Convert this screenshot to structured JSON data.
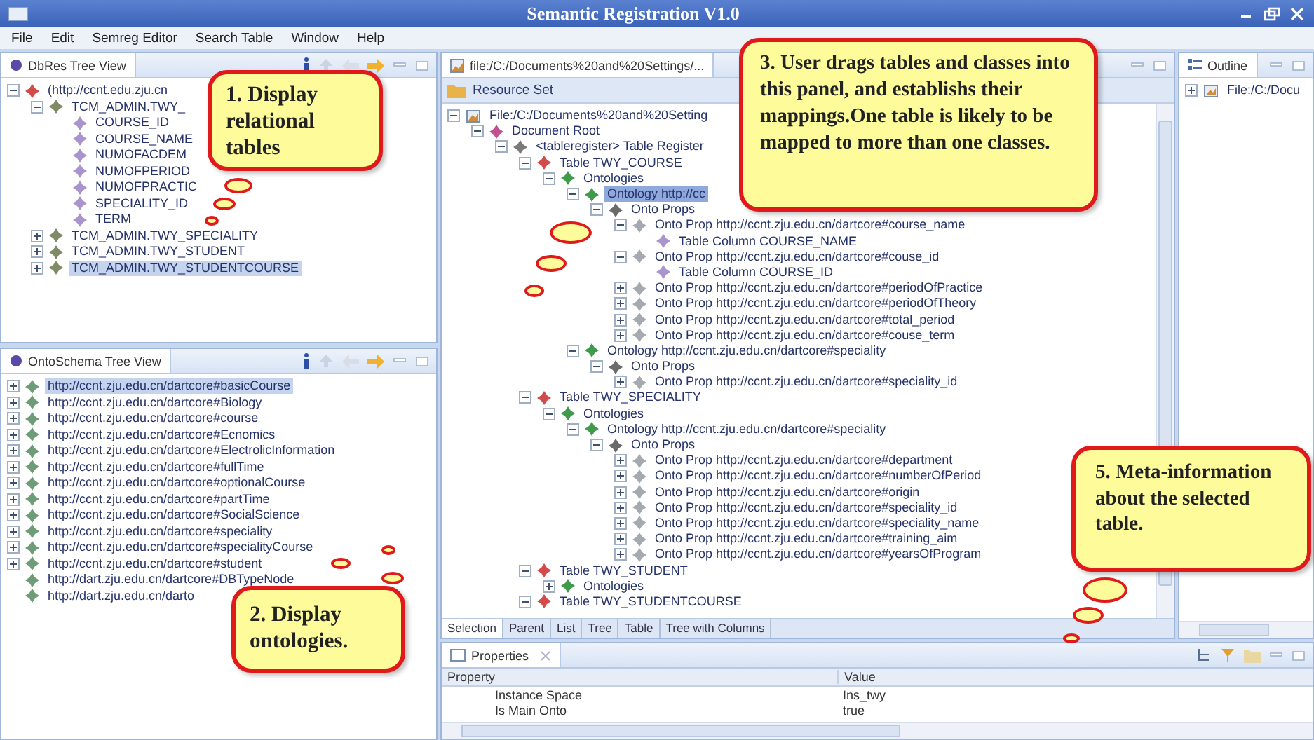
{
  "window": {
    "title": "Semantic Registration  V1.0"
  },
  "menu": [
    {
      "label": "File"
    },
    {
      "label": "Edit"
    },
    {
      "label": "Semreg Editor"
    },
    {
      "label": "Search Table"
    },
    {
      "label": "Window"
    },
    {
      "label": "Help"
    }
  ],
  "dbres_view": {
    "title": "DbRes Tree View",
    "tree": [
      {
        "label": "(http://ccnt.edu.zju.cn",
        "kind": "root",
        "expanded": true,
        "selected": false,
        "children": [
          {
            "label": "TCM_ADMIN.TWY_",
            "kind": "dbtable",
            "expanded": true,
            "selected": false,
            "children": [
              {
                "label": "COURSE_ID",
                "kind": "column",
                "selected": false
              },
              {
                "label": "COURSE_NAME",
                "kind": "column",
                "selected": false
              },
              {
                "label": "NUMOFACDEM",
                "kind": "column",
                "selected": false
              },
              {
                "label": "NUMOFPERIOD",
                "kind": "column",
                "selected": false
              },
              {
                "label": "NUMOFPRACTIC",
                "kind": "column",
                "selected": false
              },
              {
                "label": "SPECIALITY_ID",
                "kind": "column",
                "selected": false
              },
              {
                "label": "TERM",
                "kind": "column",
                "selected": false
              }
            ]
          },
          {
            "label": "TCM_ADMIN.TWY_SPECIALITY",
            "kind": "dbtable",
            "expanded": false,
            "selected": false
          },
          {
            "label": "TCM_ADMIN.TWY_STUDENT",
            "kind": "dbtable",
            "expanded": false,
            "selected": false
          },
          {
            "label": "TCM_ADMIN.TWY_STUDENTCOURSE",
            "kind": "dbtable",
            "expanded": false,
            "selected": true
          }
        ]
      }
    ]
  },
  "ontoschema_view": {
    "title": "OntoSchema Tree View",
    "tree": [
      {
        "label": "http://ccnt.zju.edu.cn/dartcore#basicCourse",
        "kind": "concept",
        "expanded": false,
        "selected": true
      },
      {
        "label": "http://ccnt.zju.edu.cn/dartcore#Biology",
        "kind": "concept",
        "expanded": false,
        "selected": false
      },
      {
        "label": "http://ccnt.zju.edu.cn/dartcore#course",
        "kind": "concept",
        "expanded": false,
        "selected": false
      },
      {
        "label": "http://ccnt.zju.edu.cn/dartcore#Ecnomics",
        "kind": "concept",
        "expanded": false,
        "selected": false
      },
      {
        "label": "http://ccnt.zju.edu.cn/dartcore#ElectrolicInformation",
        "kind": "concept",
        "expanded": false,
        "selected": false
      },
      {
        "label": "http://ccnt.zju.edu.cn/dartcore#fullTime",
        "kind": "concept",
        "expanded": false,
        "selected": false
      },
      {
        "label": "http://ccnt.zju.edu.cn/dartcore#optionalCourse",
        "kind": "concept",
        "expanded": false,
        "selected": false
      },
      {
        "label": "http://ccnt.zju.edu.cn/dartcore#partTime",
        "kind": "concept",
        "expanded": false,
        "selected": false
      },
      {
        "label": "http://ccnt.zju.edu.cn/dartcore#SocialScience",
        "kind": "concept",
        "expanded": false,
        "selected": false
      },
      {
        "label": "http://ccnt.zju.edu.cn/dartcore#speciality",
        "kind": "concept",
        "expanded": false,
        "selected": false
      },
      {
        "label": "http://ccnt.zju.edu.cn/dartcore#specialityCourse",
        "kind": "concept",
        "expanded": false,
        "selected": false
      },
      {
        "label": "http://ccnt.zju.edu.cn/dartcore#student",
        "kind": "concept",
        "expanded": false,
        "selected": false
      },
      {
        "label": "http://dart.zju.edu.cn/dartcore#DBTypeNode",
        "kind": "concept",
        "selected": false
      },
      {
        "label": "http://dart.zju.edu.cn/darto",
        "kind": "concept",
        "selected": false
      }
    ]
  },
  "editor": {
    "tab": "file:/C:/Documents%20and%20Settings/...",
    "header": "Resource Set",
    "tree": [
      {
        "label": "File:/C:/Documents%20and%20Setting",
        "kind": "file",
        "expanded": true,
        "selected": false,
        "children": [
          {
            "label": "Document Root",
            "kind": "docroot",
            "expanded": true,
            "selected": false,
            "children": [
              {
                "label": "<tableregister> Table Register",
                "kind": "register",
                "expanded": true,
                "selected": false,
                "children": [
                  {
                    "label": "Table TWY_COURSE",
                    "kind": "table",
                    "expanded": true,
                    "selected": false,
                    "children": [
                      {
                        "label": "Ontologies",
                        "kind": "ontology",
                        "expanded": true,
                        "selected": false,
                        "children": [
                          {
                            "label": "Ontology http://cc",
                            "kind": "ontology",
                            "expanded": true,
                            "selected": true,
                            "children": [
                              {
                                "label": "Onto Props",
                                "kind": "props",
                                "expanded": true,
                                "selected": false,
                                "children": [
                                  {
                                    "label": "Onto Prop http://ccnt.zju.edu.cn/dartcore#course_name",
                                    "kind": "prop",
                                    "expanded": true,
                                    "selected": false,
                                    "children": [
                                      {
                                        "label": "Table Column COURSE_NAME",
                                        "kind": "column",
                                        "selected": false
                                      }
                                    ]
                                  },
                                  {
                                    "label": "Onto Prop http://ccnt.zju.edu.cn/dartcore#couse_id",
                                    "kind": "prop",
                                    "expanded": true,
                                    "selected": false,
                                    "children": [
                                      {
                                        "label": "Table Column COURSE_ID",
                                        "kind": "column",
                                        "selected": false
                                      }
                                    ]
                                  },
                                  {
                                    "label": "Onto Prop http://ccnt.zju.edu.cn/dartcore#periodOfPractice",
                                    "kind": "prop",
                                    "expanded": false,
                                    "selected": false
                                  },
                                  {
                                    "label": "Onto Prop http://ccnt.zju.edu.cn/dartcore#periodOfTheory",
                                    "kind": "prop",
                                    "expanded": false,
                                    "selected": false
                                  },
                                  {
                                    "label": "Onto Prop http://ccnt.zju.edu.cn/dartcore#total_period",
                                    "kind": "prop",
                                    "expanded": false,
                                    "selected": false
                                  },
                                  {
                                    "label": "Onto Prop http://ccnt.zju.edu.cn/dartcore#couse_term",
                                    "kind": "prop",
                                    "expanded": false,
                                    "selected": false
                                  }
                                ]
                              }
                            ]
                          },
                          {
                            "label": "Ontology http://ccnt.zju.edu.cn/dartcore#speciality",
                            "kind": "ontology",
                            "expanded": true,
                            "selected": false,
                            "children": [
                              {
                                "label": "Onto Props",
                                "kind": "props",
                                "expanded": true,
                                "selected": false,
                                "children": [
                                  {
                                    "label": "Onto Prop http://ccnt.zju.edu.cn/dartcore#speciality_id",
                                    "kind": "prop",
                                    "expanded": false,
                                    "selected": false
                                  }
                                ]
                              }
                            ]
                          }
                        ]
                      }
                    ]
                  },
                  {
                    "label": "Table TWY_SPECIALITY",
                    "kind": "table",
                    "expanded": true,
                    "selected": false,
                    "children": [
                      {
                        "label": "Ontologies",
                        "kind": "ontology",
                        "expanded": true,
                        "selected": false,
                        "children": [
                          {
                            "label": "Ontology http://ccnt.zju.edu.cn/dartcore#speciality",
                            "kind": "ontology",
                            "expanded": true,
                            "selected": false,
                            "children": [
                              {
                                "label": "Onto Props",
                                "kind": "props",
                                "expanded": true,
                                "selected": false,
                                "children": [
                                  {
                                    "label": "Onto Prop http://ccnt.zju.edu.cn/dartcore#department",
                                    "kind": "prop",
                                    "expanded": false,
                                    "selected": false
                                  },
                                  {
                                    "label": "Onto Prop http://ccnt.zju.edu.cn/dartcore#numberOfPeriod",
                                    "kind": "prop",
                                    "expanded": false,
                                    "selected": false
                                  },
                                  {
                                    "label": "Onto Prop http://ccnt.zju.edu.cn/dartcore#origin",
                                    "kind": "prop",
                                    "expanded": false,
                                    "selected": false
                                  },
                                  {
                                    "label": "Onto Prop http://ccnt.zju.edu.cn/dartcore#speciality_id",
                                    "kind": "prop",
                                    "expanded": false,
                                    "selected": false
                                  },
                                  {
                                    "label": "Onto Prop http://ccnt.zju.edu.cn/dartcore#speciality_name",
                                    "kind": "prop",
                                    "expanded": false,
                                    "selected": false
                                  },
                                  {
                                    "label": "Onto Prop http://ccnt.zju.edu.cn/dartcore#training_aim",
                                    "kind": "prop",
                                    "expanded": false,
                                    "selected": false
                                  },
                                  {
                                    "label": "Onto Prop http://ccnt.zju.edu.cn/dartcore#yearsOfProgram",
                                    "kind": "prop",
                                    "expanded": false,
                                    "selected": false
                                  }
                                ]
                              }
                            ]
                          }
                        ]
                      }
                    ]
                  },
                  {
                    "label": "Table TWY_STUDENT",
                    "kind": "table",
                    "expanded": true,
                    "selected": false,
                    "children": [
                      {
                        "label": "Ontologies",
                        "kind": "ontology",
                        "expanded": false,
                        "selected": false
                      }
                    ]
                  },
                  {
                    "label": "Table TWY_STUDENTCOURSE",
                    "kind": "table",
                    "expanded": true,
                    "selected": false
                  }
                ]
              }
            ]
          }
        ]
      }
    ],
    "tabs": [
      {
        "label": "Selection",
        "selected": true
      },
      {
        "label": "Parent",
        "selected": false
      },
      {
        "label": "List",
        "selected": false
      },
      {
        "label": "Tree",
        "selected": false
      },
      {
        "label": "Table",
        "selected": false
      },
      {
        "label": "Tree with Columns",
        "selected": false
      }
    ]
  },
  "outline": {
    "title": "Outline",
    "tree": [
      {
        "label": "File:/C:/Docu",
        "kind": "file",
        "expanded": false,
        "selected": false
      }
    ]
  },
  "properties": {
    "title": "Properties",
    "columns": [
      "Property",
      "Value"
    ],
    "rows": [
      {
        "property": "Instance Space",
        "value": "Ins_twy"
      },
      {
        "property": "Is Main Onto",
        "value": "true"
      }
    ]
  },
  "callouts": [
    {
      "text": "1. Display relational tables"
    },
    {
      "text": "2. Display ontologies."
    },
    {
      "text": "3. User drags tables and classes into this panel, and establishs their mappings.One table is likely to be mapped to more than one classes."
    },
    {
      "text": "5. Meta-information about the selected table."
    }
  ]
}
